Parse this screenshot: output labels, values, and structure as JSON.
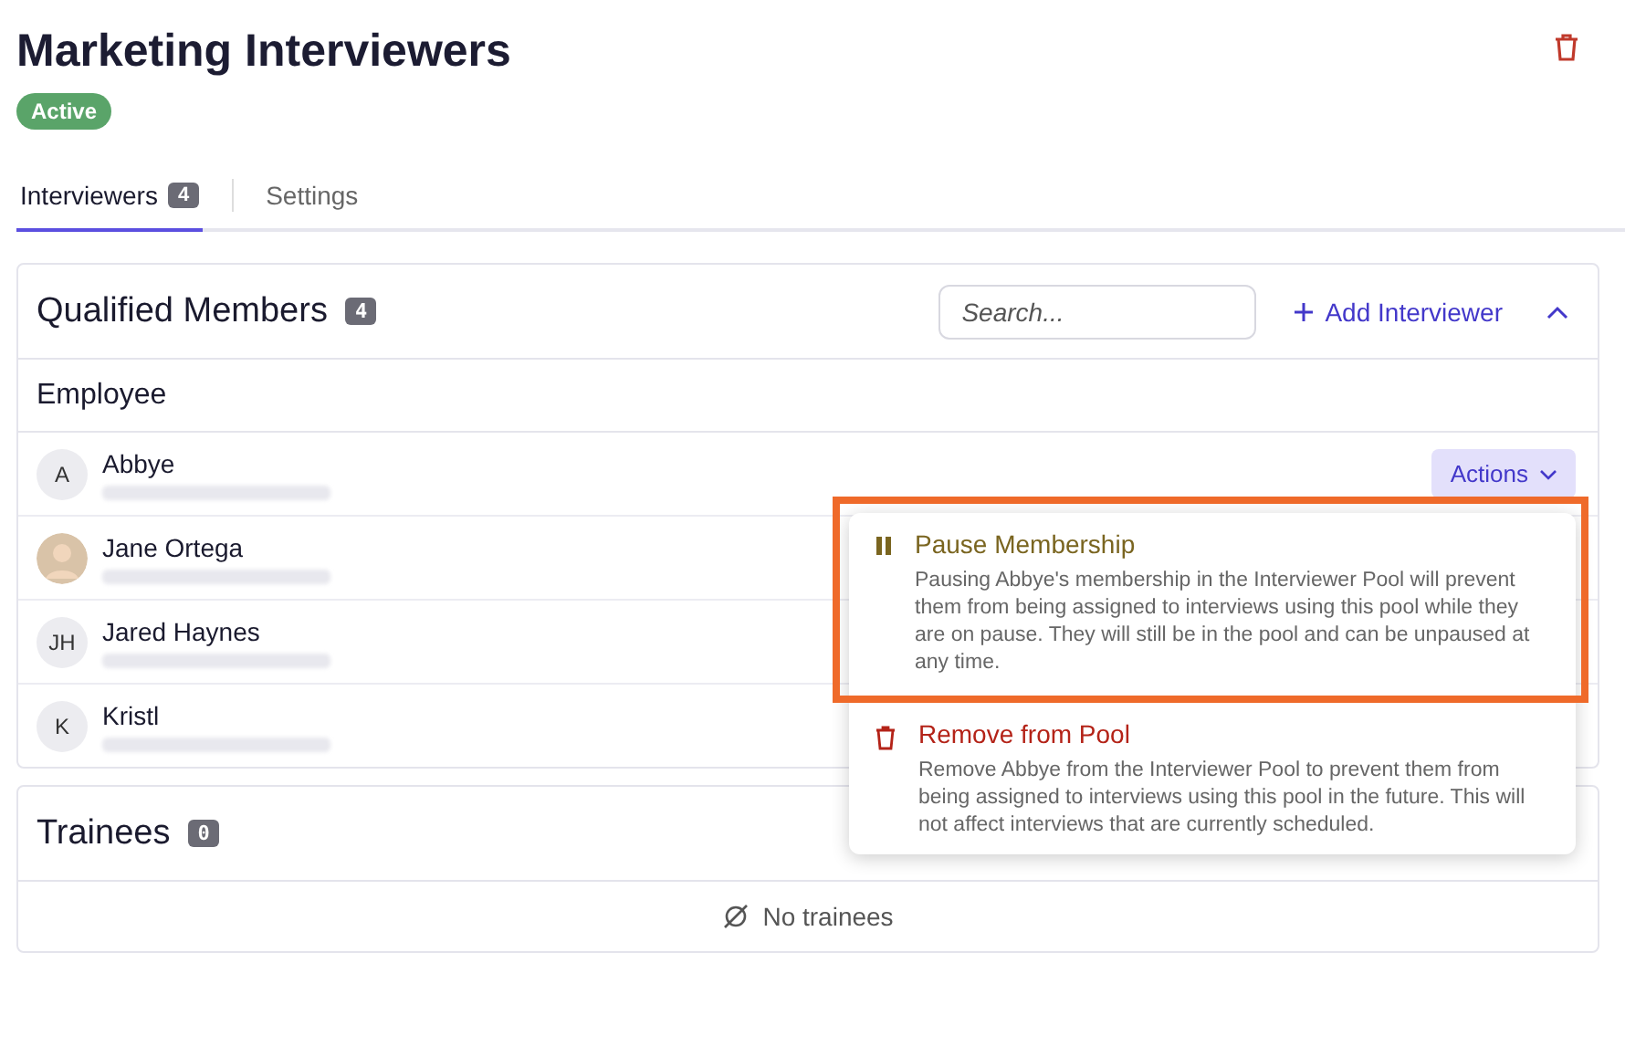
{
  "title": "Marketing Interviewers",
  "status": "Active",
  "tabs": [
    {
      "label": "Interviewers",
      "count": "4",
      "selected": true
    },
    {
      "label": "Settings",
      "selected": false
    }
  ],
  "qualified": {
    "title": "Qualified Members",
    "count": "4",
    "search": {
      "placeholder": "Search..."
    },
    "add_button": "Add Interviewer",
    "expanded": true,
    "group": "Employee",
    "members": [
      {
        "kind": "initials",
        "initials": "A",
        "name": "Abbye",
        "actions": "Actions"
      },
      {
        "kind": "photo",
        "name": "Jane Ortega"
      },
      {
        "kind": "initials",
        "initials": "JH",
        "name": "Jared Haynes"
      },
      {
        "kind": "initials",
        "initials": "K",
        "name": "Kristl"
      }
    ]
  },
  "menu": [
    {
      "kind": "pause",
      "label": "Pause Membership",
      "description": "Pausing Abbye's membership in the Interviewer Pool will prevent them from being assigned to interviews using this pool while they are on pause. They will still be in the pool and can be unpaused at any time.",
      "highlighted": true
    },
    {
      "kind": "remove",
      "label": "Remove from Pool",
      "description": "Remove Abbye from the Interviewer Pool to prevent them from being assigned to interviews using this pool in the future. This will not affect interviews that are currently scheduled.",
      "highlighted": false
    }
  ],
  "trainees": {
    "title": "Trainees",
    "count": "0",
    "empty": "No trainees"
  }
}
